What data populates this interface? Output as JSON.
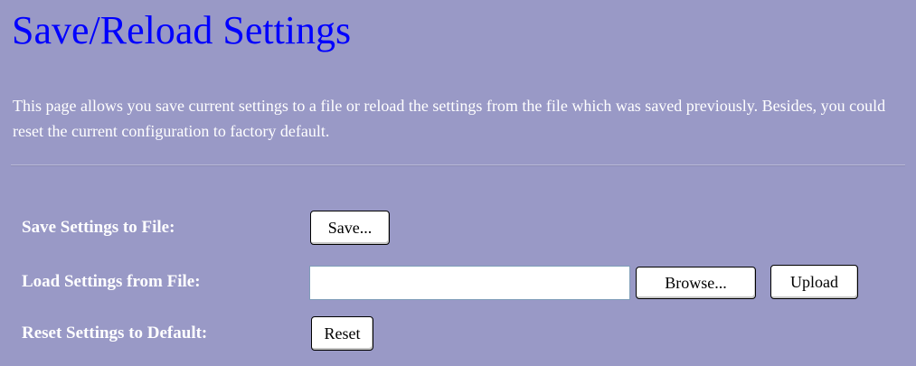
{
  "page": {
    "title": "Save/Reload Settings",
    "description": "This page allows you save current settings to a file or reload the settings from the file which was saved previously. Besides, you could reset the current configuration to factory default."
  },
  "settings": {
    "save": {
      "label": "Save Settings to File:",
      "button_label": "Save..."
    },
    "load": {
      "label": "Load Settings from File:",
      "file_value": "",
      "browse_label": "Browse...",
      "upload_label": "Upload"
    },
    "reset": {
      "label": "Reset Settings to Default:",
      "button_label": "Reset"
    }
  },
  "colors": {
    "background": "#9999c6",
    "title": "#0000ff",
    "text": "#ffffff"
  }
}
